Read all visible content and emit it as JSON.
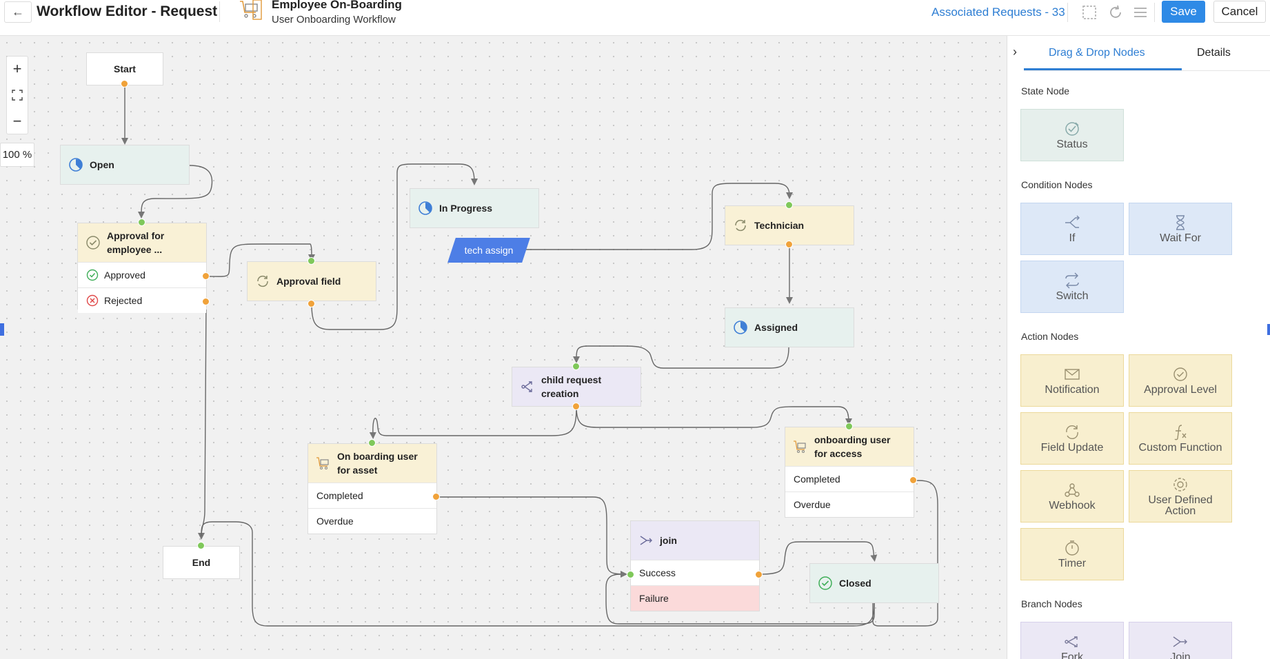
{
  "header": {
    "title": "Workflow Editor - Request",
    "workflow_name": "Employee On-Boarding",
    "workflow_subtitle": "User Onboarding Workflow",
    "associated_requests": "Associated Requests - 33",
    "save_label": "Save",
    "cancel_label": "Cancel"
  },
  "canvas": {
    "zoom_level": "100 %",
    "nodes": {
      "start": "Start",
      "open": "Open",
      "approval_employee": "Approval for employee ...",
      "approval_employee_approved": "Approved",
      "approval_employee_rejected": "Rejected",
      "approval_field": "Approval field",
      "in_progress": "In Progress",
      "tech_assign": "tech assign",
      "technician": "Technician",
      "assigned": "Assigned",
      "child_request": "child request creation",
      "onboard_asset": "On boarding user for asset",
      "onboard_asset_completed": "Completed",
      "onboard_asset_overdue": "Overdue",
      "onboard_access": "onboarding user for access",
      "onboard_access_completed": "Completed",
      "onboard_access_overdue": "Overdue",
      "join": "join",
      "join_success": "Success",
      "join_failure": "Failure",
      "closed": "Closed",
      "end": "End"
    }
  },
  "panel": {
    "tabs": [
      "Drag & Drop Nodes",
      "Details"
    ],
    "sections": {
      "state": "State Node",
      "condition": "Condition Nodes",
      "action": "Action Nodes",
      "branch": "Branch Nodes"
    },
    "tiles": {
      "status": "Status",
      "if": "If",
      "wait_for": "Wait For",
      "switch": "Switch",
      "notification": "Notification",
      "approval_level": "Approval Level",
      "field_update": "Field Update",
      "custom_function": "Custom Function",
      "webhook": "Webhook",
      "user_defined_action": "User Defined Action",
      "timer": "Timer",
      "fork": "Fork",
      "join": "Join"
    }
  },
  "colors": {
    "accent": "#2e8ae6",
    "state_node": "#e7f1ee",
    "action_node": "#f9f1d6",
    "branch_node": "#ebe8f5",
    "condition_node": "#dde8f7",
    "failure_row": "#fbdada",
    "port_out": "#f0a23a",
    "port_in": "#7fc85a"
  }
}
